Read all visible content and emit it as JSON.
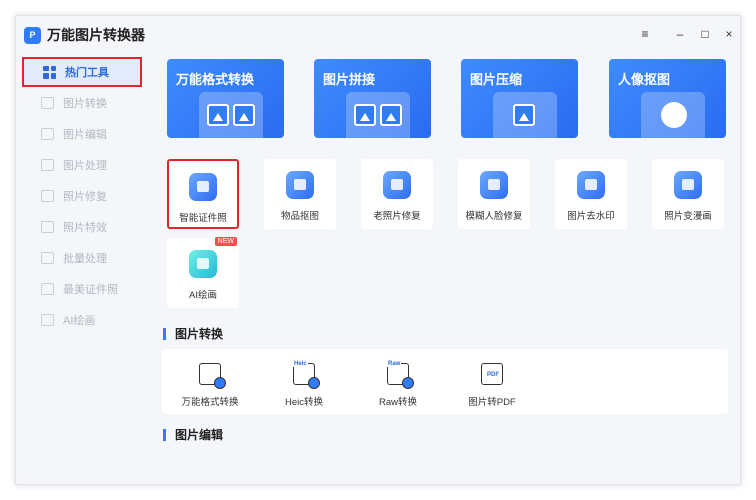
{
  "app": {
    "logo_text": "P",
    "title": "万能图片转换器"
  },
  "window_controls": {
    "menu": "≡",
    "minimize": "–",
    "maximize": "□",
    "close": "×"
  },
  "sidebar": {
    "items": [
      {
        "label": "热门工具",
        "active": true
      },
      {
        "label": "图片转换"
      },
      {
        "label": "图片编辑"
      },
      {
        "label": "图片处理"
      },
      {
        "label": "照片修复"
      },
      {
        "label": "照片特效"
      },
      {
        "label": "批量处理"
      },
      {
        "label": "最美证件照"
      },
      {
        "label": "AI绘画"
      }
    ]
  },
  "banners": [
    {
      "title": "万能格式转换"
    },
    {
      "title": "图片拼接"
    },
    {
      "title": "图片压缩"
    },
    {
      "title": "人像抠图"
    }
  ],
  "tools": [
    {
      "label": "智能证件照",
      "icon": "id-photo-icon"
    },
    {
      "label": "物品抠图",
      "icon": "cutout-icon"
    },
    {
      "label": "老照片修复",
      "icon": "repair-icon"
    },
    {
      "label": "模糊人脸修复",
      "icon": "face-repair-icon"
    },
    {
      "label": "图片去水印",
      "icon": "watermark-icon"
    },
    {
      "label": "照片变漫画",
      "icon": "cartoon-icon"
    },
    {
      "label": "AI绘画",
      "icon": "ai-paint-icon",
      "badge": "NEW"
    }
  ],
  "sections": {
    "convert": {
      "title": "图片转换",
      "items": [
        {
          "label": "万能格式转换",
          "tag": ""
        },
        {
          "label": "Heic转换",
          "tag": "Heic"
        },
        {
          "label": "Raw转换",
          "tag": "Raw"
        },
        {
          "label": "图片转PDF",
          "tag": "PDF"
        }
      ]
    },
    "edit": {
      "title": "图片编辑"
    }
  },
  "colors": {
    "accent": "#2f7cf6",
    "highlight": "#e0262a",
    "bg": "#f4f6fa"
  }
}
